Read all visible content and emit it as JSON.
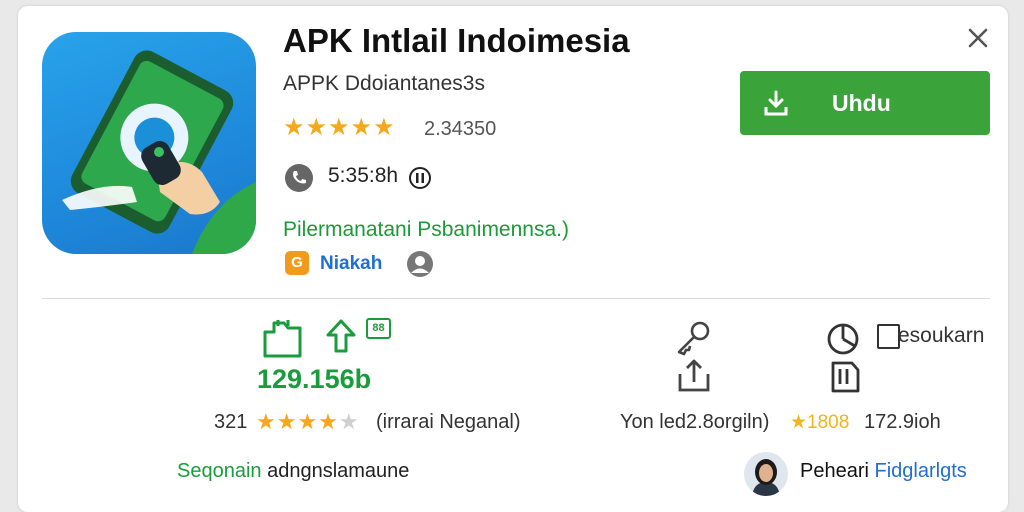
{
  "app": {
    "title": "APK Intlail Indoimesia",
    "subtitle": "APPK Ddoiantanes3s",
    "rating_stars": "★★★★★",
    "rating_value": "2.34350",
    "size_text": "5:35:8h",
    "description": "Pilermanatani Psbanimennsa.)",
    "developer_badge": "G",
    "developer_name": "Niakah"
  },
  "actions": {
    "download_label": "Uhdu",
    "close_label": "×"
  },
  "stats": {
    "badge": "88",
    "value": "129.156b",
    "review_count": "321",
    "review_stars": "★★★★",
    "review_star_empty": "★",
    "review_label": "(irrarai Neganal)",
    "right_text": "Yon led2.8orgiln)",
    "right_stars": "★1808",
    "right_num": "172.9ioh",
    "check_label": "esoukarn"
  },
  "footer": {
    "left_green": "Seqonain",
    "left_rest": "adngnslamaune",
    "right_first": "Peheari",
    "right_second": "Fidglarlgts"
  },
  "colors": {
    "accent_green": "#3aa43a",
    "text_green": "#1a9c3c",
    "link_blue": "#1f6fd0",
    "star_orange": "#f5a81c",
    "icon_blue": "#1f8bdc"
  }
}
